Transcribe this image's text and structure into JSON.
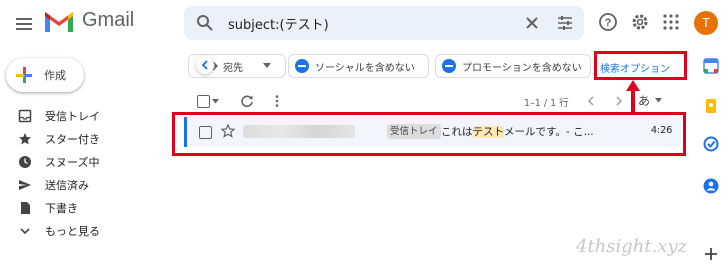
{
  "header": {
    "app_name": "Gmail",
    "search_value": "subject:(テスト)",
    "avatar_initial": "T"
  },
  "sidebar": {
    "compose_label": "作成",
    "items": [
      {
        "label": "受信トレイ",
        "icon": "inbox-icon"
      },
      {
        "label": "スター付き",
        "icon": "star-icon"
      },
      {
        "label": "スヌーズ中",
        "icon": "clock-icon"
      },
      {
        "label": "送信済み",
        "icon": "send-icon"
      },
      {
        "label": "下書き",
        "icon": "draft-icon"
      },
      {
        "label": "もっと見る",
        "icon": "chevron-down-icon"
      }
    ]
  },
  "filters": {
    "recipient_chip": "宛先",
    "social_chip": "ソーシャルを含めない",
    "promo_chip": "プロモーションを含めない",
    "advanced_search": "検索オプション"
  },
  "toolbar": {
    "pagination": "1–1 / 1 行",
    "language": "あ"
  },
  "email": {
    "label": "受信トレイ",
    "subject_before": "これは",
    "subject_highlight": "テスト",
    "subject_after": "メールです。- こ...",
    "time": "4:26"
  },
  "watermark": "4thsight.xyz",
  "colors": {
    "highlight_border": "#e0001b",
    "link": "#1a73e8",
    "search_bg": "#eaf1fb",
    "avatar": "#e8710a"
  }
}
